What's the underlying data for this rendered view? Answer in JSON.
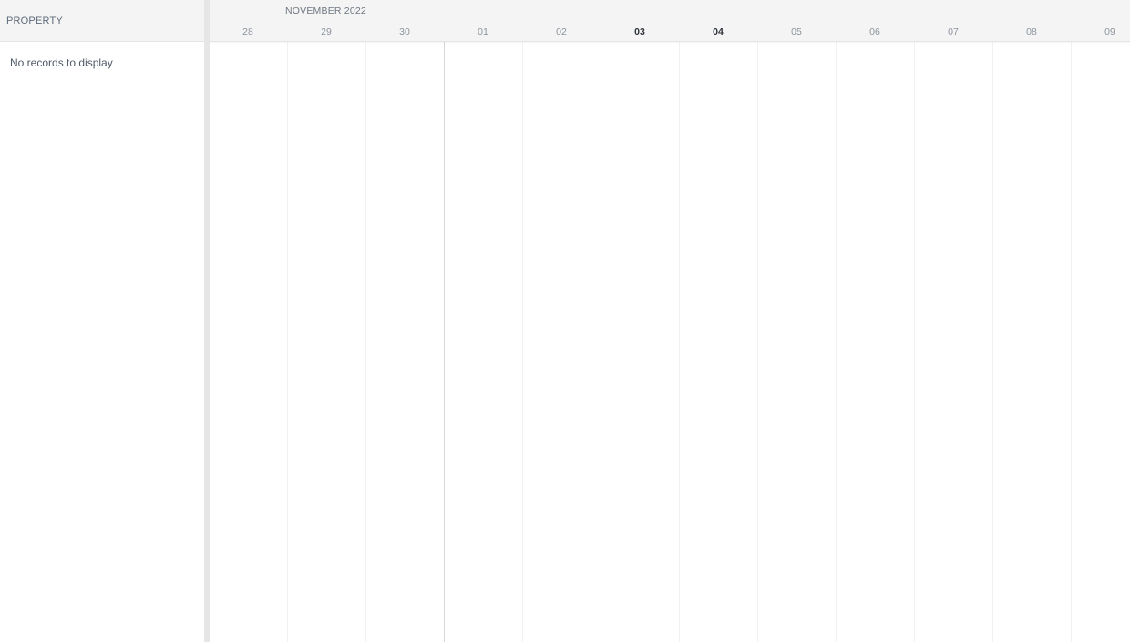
{
  "property_panel": {
    "header_label": "PROPERTY",
    "empty_message": "No records to display"
  },
  "timeline": {
    "month_label": "NOVEMBER 2022",
    "days": [
      {
        "label": "28",
        "highlight": false
      },
      {
        "label": "29",
        "highlight": false
      },
      {
        "label": "30",
        "highlight": false
      },
      {
        "label": "01",
        "highlight": false
      },
      {
        "label": "02",
        "highlight": false
      },
      {
        "label": "03",
        "highlight": true
      },
      {
        "label": "04",
        "highlight": true
      },
      {
        "label": "05",
        "highlight": false
      },
      {
        "label": "06",
        "highlight": false
      },
      {
        "label": "07",
        "highlight": false
      },
      {
        "label": "08",
        "highlight": false
      },
      {
        "label": "09",
        "highlight": false
      }
    ]
  },
  "colors": {
    "header_bg": "#f4f4f4",
    "splitter": "#e6e6e6",
    "text_muted": "#8c949c",
    "text_strong": "#2f343a"
  }
}
